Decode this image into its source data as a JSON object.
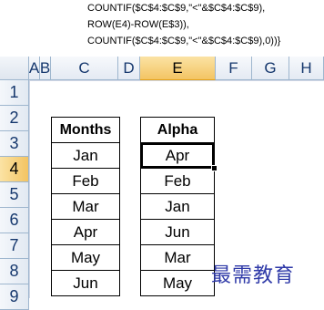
{
  "formula_bar": {
    "lines": [
      "COUNTIF($C$4:$C$9,\"<\"&$C$4:$C$9),",
      "ROW(E4)-ROW(E$3)),",
      "COUNTIF($C$4:$C$9,\"<\"&$C$4:$C$9),0))}"
    ]
  },
  "columns": [
    "A",
    "B",
    "C",
    "D",
    "E",
    "F",
    "G",
    "H"
  ],
  "rows": [
    "1",
    "2",
    "3",
    "4",
    "5",
    "6",
    "7",
    "8",
    "9"
  ],
  "active_column": "E",
  "active_row": "4",
  "table_months": {
    "header": "Months",
    "values": [
      "Jan",
      "Feb",
      "Mar",
      "Apr",
      "May",
      "Jun"
    ]
  },
  "table_alpha": {
    "header": "Alpha",
    "values": [
      "Apr",
      "Feb",
      "Jan",
      "Jun",
      "Mar",
      "May"
    ]
  },
  "watermark": "最需教育"
}
